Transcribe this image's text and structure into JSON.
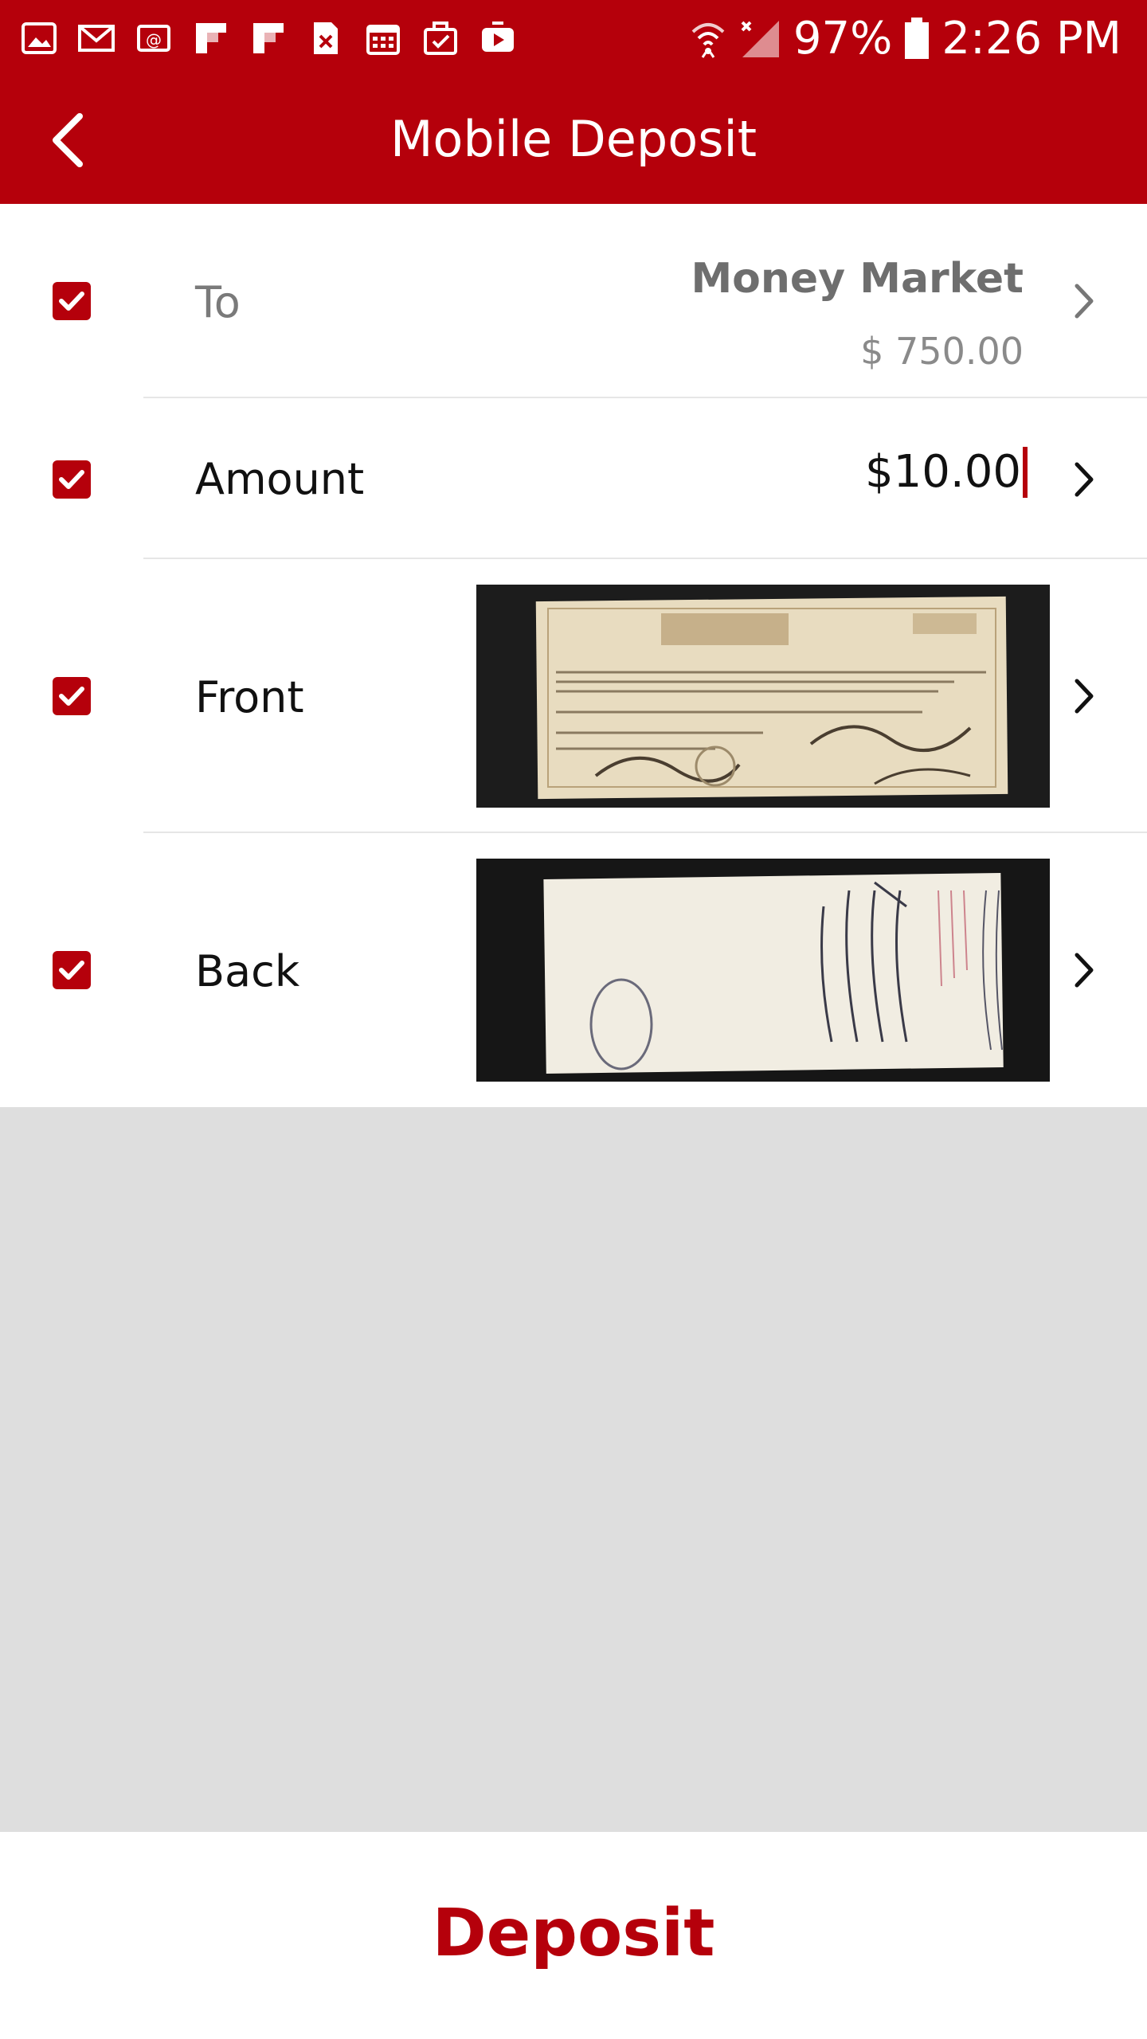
{
  "status_bar": {
    "icons": [
      "gallery-icon",
      "gmail-icon",
      "email-icon",
      "flipboard-icon",
      "flipboard-icon",
      "excel-icon",
      "calendar-icon",
      "task-icon",
      "youtube-icon"
    ],
    "battery": "97%",
    "time": "2:26 PM"
  },
  "header": {
    "title": "Mobile Deposit"
  },
  "form": {
    "to": {
      "label": "To",
      "account_name": "Money Market",
      "account_balance": "$ 750.00"
    },
    "amount": {
      "label": "Amount",
      "value": "$10.00"
    },
    "front": {
      "label": "Front"
    },
    "back": {
      "label": "Back"
    }
  },
  "footer": {
    "deposit_label": "Deposit"
  },
  "colors": {
    "brand_red": "#b5000b",
    "divider": "#e6e6e6",
    "empty_area": "#dedede"
  }
}
